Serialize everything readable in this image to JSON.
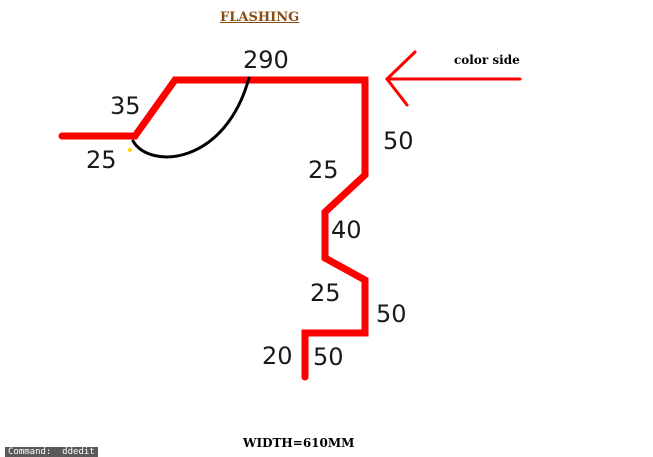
{
  "title": "FLASHING",
  "color_side_label": "color side",
  "width_label": "WIDTH=610MM",
  "command_line": "Command:  ddedit",
  "dimensions": {
    "top": "290",
    "slope": "35",
    "lip": "25",
    "right_drop": "50",
    "step_in": "25",
    "middle": "40",
    "step_out": "25",
    "lower_drop": "50",
    "bottom_return": "20",
    "bottom_leg": "50"
  },
  "colors": {
    "profile": "#ff0000",
    "arc": "#000000",
    "arrow": "#ff0000",
    "title": "#8a4b12"
  }
}
